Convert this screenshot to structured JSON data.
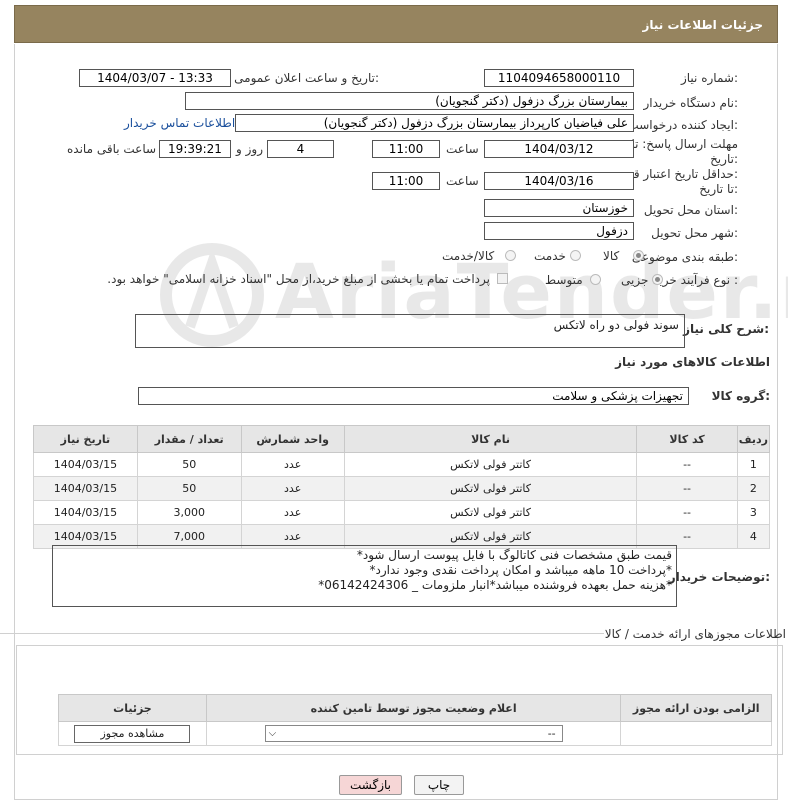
{
  "header": {
    "title": "جزئیات اطلاعات نیاز"
  },
  "form": {
    "need_number": {
      "label": "شماره نیاز:",
      "value": "1104094658000110"
    },
    "announce": {
      "label": "تاریخ و ساعت اعلان عمومی:",
      "value": "1404/03/07 - 13:33"
    },
    "buyer_org": {
      "label": "نام دستگاه خریدار:",
      "value": "بیمارستان بزرگ دزفول (دکتر گنجویان)"
    },
    "requester": {
      "label": "ایجاد کننده درخواست:",
      "value": "علی فیاضیان کارپرداز بیمارستان بزرگ دزفول (دکتر گنجویان)"
    },
    "buyer_contact_link": "اطلاعات تماس خریدار",
    "reply_deadline": {
      "label_line1": "مهلت ارسال پاسخ: تا",
      "label_line2": "تاریخ:",
      "date": "1404/03/12",
      "time_label": "ساعت",
      "time": "11:00",
      "days": "4",
      "days_label": "روز و",
      "remaining": "19:39:21",
      "remaining_label": "ساعت باقی مانده"
    },
    "price_validity": {
      "label_line1": "حداقل تاریخ اعتبار قیمت:",
      "label_line2": "تا تاریخ:",
      "date": "1404/03/16",
      "time_label": "ساعت",
      "time": "11:00"
    },
    "province": {
      "label": "استان محل تحویل:",
      "value": "خوزستان"
    },
    "city": {
      "label": "شهر محل تحویل:",
      "value": "دزفول"
    },
    "category": {
      "label": "طبقه بندی موضوعی:",
      "options": [
        "کالا",
        "خدمت",
        "کالا/خدمت"
      ],
      "selected": "کالا"
    },
    "purchase_process": {
      "label": "نوع فرآیند خرید :",
      "options": [
        "جزیی",
        "متوسط"
      ],
      "selected": "جزیی",
      "payment_note": "پرداخت تمام یا بخشی از مبلغ خرید،از محل \"اسناد خزانه اسلامی\" خواهد بود."
    }
  },
  "summary": {
    "label": "شرح کلی نیاز:",
    "value": "سوند فولی دو راه لاتکس"
  },
  "goods": {
    "section_title": "اطلاعات کالاهای مورد نیاز",
    "group_label": "گروه کالا:",
    "group_value": "تجهیزات پزشکی و سلامت",
    "columns": [
      "ردیف",
      "کد کالا",
      "نام کالا",
      "واحد شمارش",
      "تعداد / مقدار",
      "تاریخ نیاز"
    ],
    "rows": [
      {
        "row": "1",
        "code": "--",
        "name": "کاتتر فولی لاتکس",
        "unit": "عدد",
        "qty": "50",
        "date": "1404/03/15"
      },
      {
        "row": "2",
        "code": "--",
        "name": "کاتتر فولی لاتکس",
        "unit": "عدد",
        "qty": "50",
        "date": "1404/03/15"
      },
      {
        "row": "3",
        "code": "--",
        "name": "کاتتر فولی لاتکس",
        "unit": "عدد",
        "qty": "3,000",
        "date": "1404/03/15"
      },
      {
        "row": "4",
        "code": "--",
        "name": "کاتتر فولی لاتکس",
        "unit": "عدد",
        "qty": "7,000",
        "date": "1404/03/15"
      }
    ]
  },
  "buyer_notes": {
    "label": "توضیحات خریدار:",
    "lines": [
      "قیمت طبق مشخصات فنی کاتالوگ با فایل پیوست ارسال شود*",
      "*پرداخت 10 ماهه میباشد و امکان پرداخت نقدی وجود ندارد*",
      "*هزینه حمل بعهده فروشنده میباشد*انبار ملزومات _ 06142424306*"
    ]
  },
  "permits": {
    "section_title": "اطلاعات مجوزهای ارائه خدمت / کالا",
    "columns": [
      "الزامی بودن ارائه مجوز",
      "اعلام وضعیت مجوز توسط تامین کننده",
      "جزئیات"
    ],
    "status_value": "--",
    "view_button": "مشاهده مجوز"
  },
  "footer": {
    "print_button": "چاپ",
    "back_button": "بازگشت"
  },
  "watermark": {
    "text": "AriaTender.neT"
  },
  "colors": {
    "header_bg": "#96845f",
    "link": "#1a4f9c",
    "back_button_bg": "#f6d6d6"
  }
}
